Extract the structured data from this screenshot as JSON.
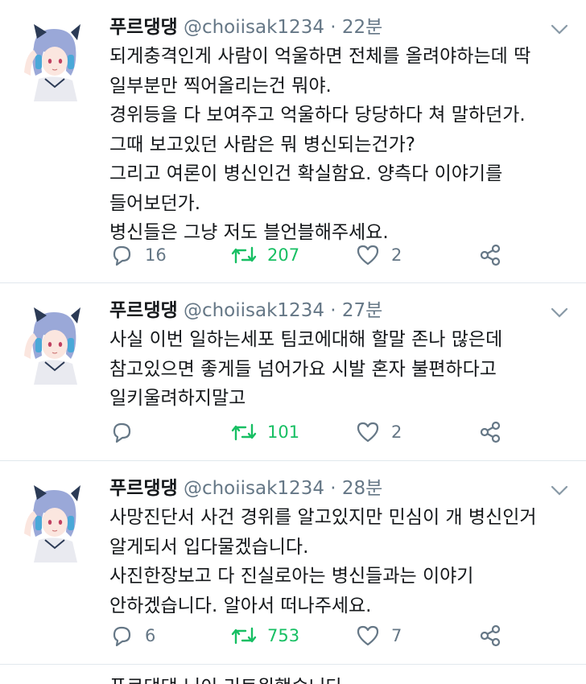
{
  "tweets": [
    {
      "name": "푸르댕댕",
      "handle": "@choiisak1234",
      "separator": "·",
      "time": "22분",
      "lines": [
        "되게충격인게 사람이 억울하면 전체를 올려야하는데 딱",
        "일부분만 찍어올리는건 뭐야.",
        "경위등을 다 보여주고 억울하다 당당하다 쳐 말하던가.",
        "그때 보고있던 사람은 뭐 병신되는건가?",
        "그리고 여론이 병신인건 확실함요. 양측다 이야기를",
        "들어보던가.",
        "병신들은 그냥 저도 블언블해주세요."
      ],
      "replies": "16",
      "retweets": "207",
      "likes": "2"
    },
    {
      "name": "푸르댕댕",
      "handle": "@choiisak1234",
      "separator": "·",
      "time": "27분",
      "lines": [
        "사실 이번 일하는세포 팀코에대해 할말 존나 많은데",
        "참고있으면 좋게들 넘어가요 시발 혼자 불편하다고",
        "일키울려하지말고"
      ],
      "replies": "",
      "retweets": "101",
      "likes": "2"
    },
    {
      "name": "푸르댕댕",
      "handle": "@choiisak1234",
      "separator": "·",
      "time": "28분",
      "lines": [
        "사망진단서 사건 경위를 알고있지만 민심이 개 병신인거",
        "알게되서 입다물겠습니다.",
        "사진한장보고 다 진실로아는 병신들과는 이야기",
        "안하겠습니다. 알아서 떠나주세요."
      ],
      "replies": "6",
      "retweets": "753",
      "likes": "7"
    }
  ],
  "bottom_peek_text": "푸르댕댕 님이 리트윗했습니다",
  "colors": {
    "text": "#14171a",
    "muted": "#657786",
    "retweet_green": "#17bf63",
    "divider": "#e1e8ed"
  },
  "icons": [
    "avatar-image",
    "chevron-down-icon",
    "reply-icon",
    "retweet-icon",
    "like-icon",
    "share-icon"
  ]
}
